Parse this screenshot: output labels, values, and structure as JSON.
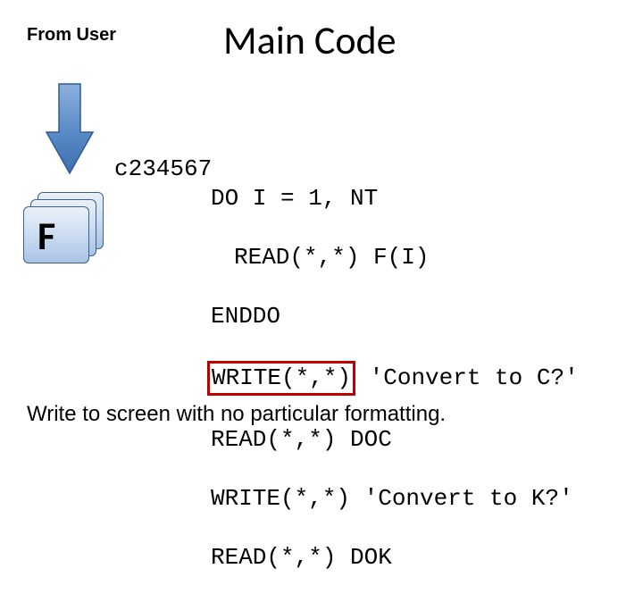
{
  "labels": {
    "from_user": "From User",
    "title": "Main Code",
    "file_letter": "F"
  },
  "code": {
    "l1": "c234567",
    "l2": "DO I = 1, NT",
    "l3": "READ(*,*) F(I)",
    "l4": "ENDDO",
    "l5a": "WRITE(*,*)",
    "l5b": " 'Convert to C?'",
    "l6": "READ(*,*) DOC",
    "l7": "WRITE(*,*) 'Convert to K?'",
    "l8": "READ(*,*) DOK"
  },
  "caption": "Write to screen with no particular formatting.",
  "colors": {
    "arrow_fill_top": "#6e99d4",
    "arrow_fill_bottom": "#3d6fae",
    "arrow_stroke": "#2f5a94",
    "highlight_border": "#c00000"
  }
}
